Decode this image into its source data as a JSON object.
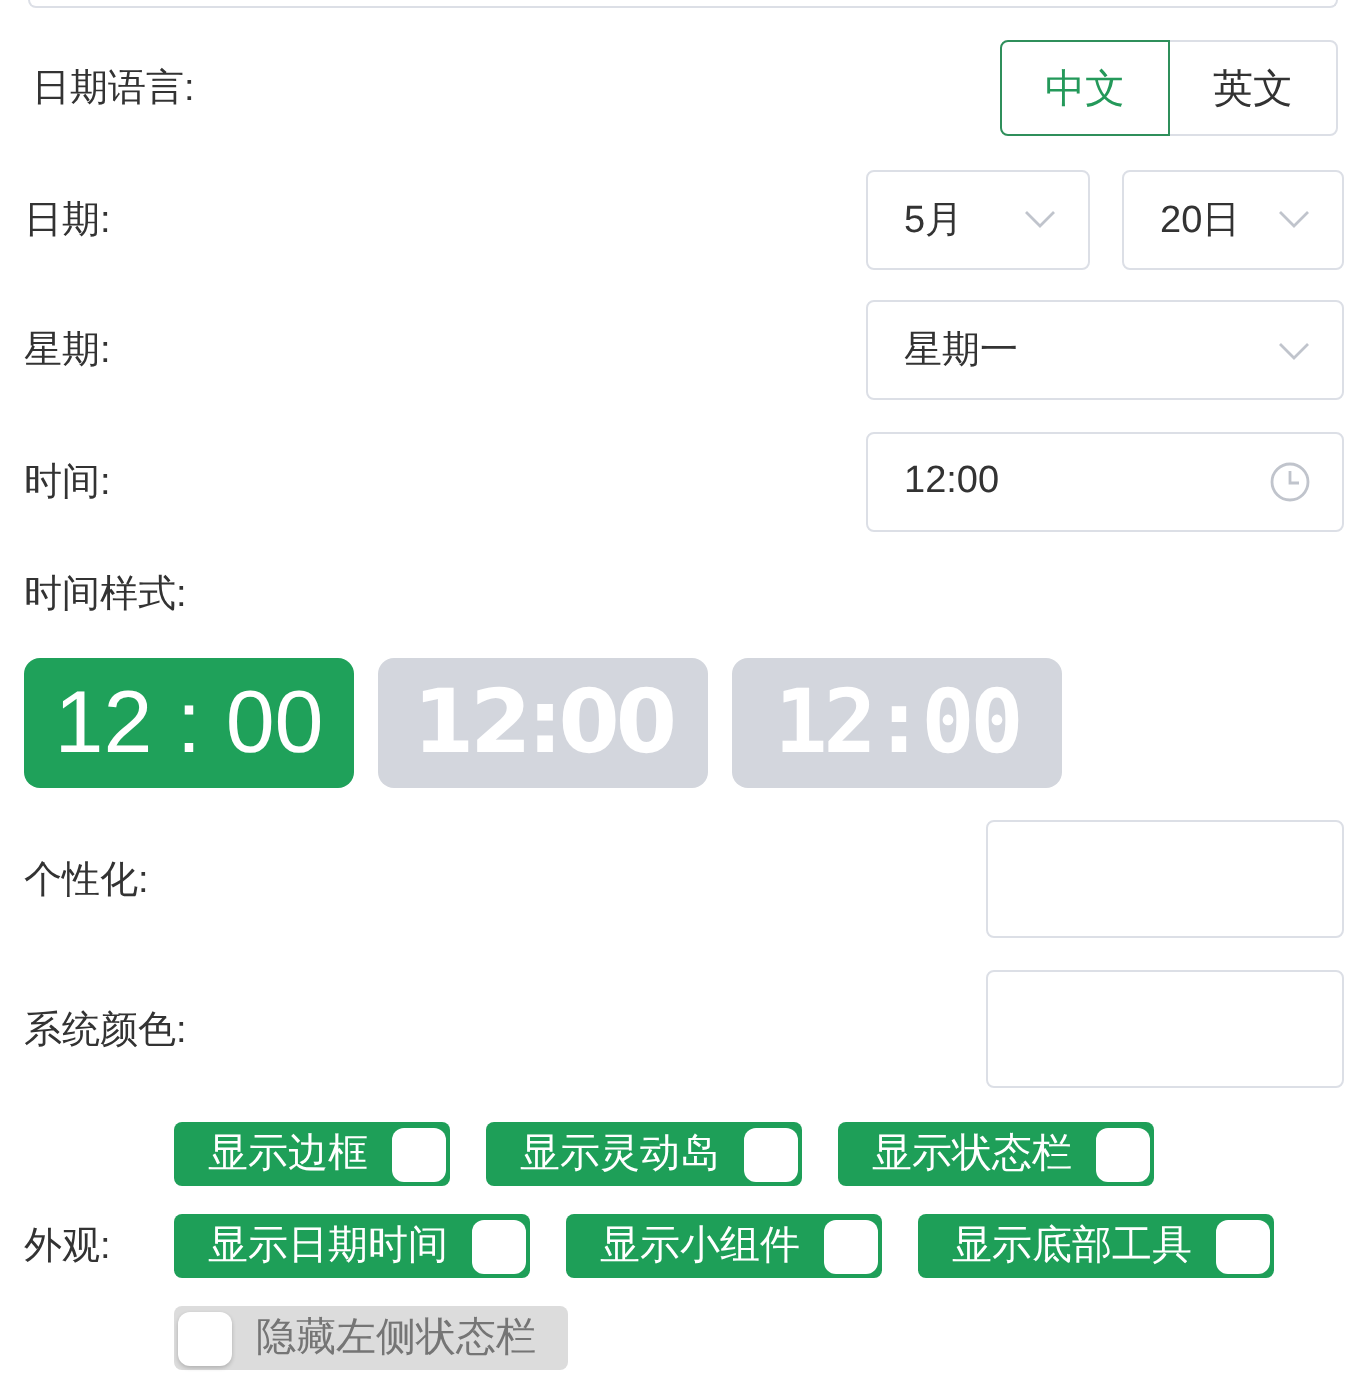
{
  "date_language": {
    "label": "日期语言:",
    "options": [
      {
        "label": "中文",
        "selected": true
      },
      {
        "label": "英文",
        "selected": false
      }
    ]
  },
  "date": {
    "label": "日期:",
    "month": "5月",
    "day": "20日"
  },
  "weekday": {
    "label": "星期:",
    "value": "星期一"
  },
  "time": {
    "label": "时间:",
    "value": "12:00"
  },
  "time_style": {
    "label": "时间样式:",
    "options": [
      {
        "text": "12 : 00",
        "kind": "plain",
        "selected": true
      },
      {
        "text": "12:00",
        "kind": "stencil",
        "selected": false
      },
      {
        "text": "12:00",
        "kind": "lined",
        "selected": false
      }
    ]
  },
  "personalize": {
    "label": "个性化:"
  },
  "system_color": {
    "label": "系统颜色:"
  },
  "appearance": {
    "label": "外观:",
    "switches": [
      {
        "label": "显示边框",
        "on": true
      },
      {
        "label": "显示灵动岛",
        "on": true
      },
      {
        "label": "显示状态栏",
        "on": true
      },
      {
        "label": "显示日期时间",
        "on": true
      },
      {
        "label": "显示小组件",
        "on": true
      },
      {
        "label": "显示底部工具",
        "on": true
      },
      {
        "label": "隐藏左侧状态栏",
        "on": false
      }
    ]
  }
}
